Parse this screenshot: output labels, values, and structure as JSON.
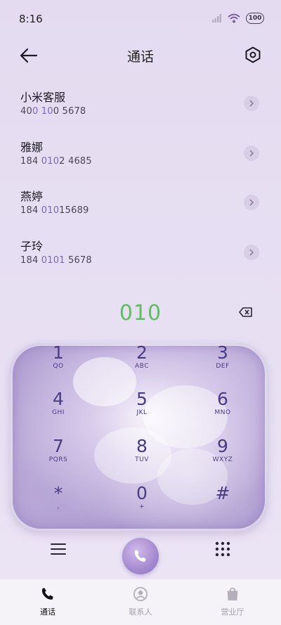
{
  "status": {
    "time": "8:16",
    "battery": "100"
  },
  "header": {
    "title": "通话"
  },
  "contacts": [
    {
      "name": "小米客服",
      "number_pre": "40",
      "number_hl": "0 10",
      "number_post": "0 5678"
    },
    {
      "name": "雅娜",
      "number_pre": "184 ",
      "number_hl": "010",
      "number_post": "2 4685"
    },
    {
      "name": "燕婷",
      "number_pre": "184 ",
      "number_hl": "010",
      "number_post": "15689"
    },
    {
      "name": "子玲",
      "number_pre": "184 ",
      "number_hl": "0101",
      "number_post": " 5678"
    }
  ],
  "dialed_number": "010",
  "keypad": [
    {
      "digit": "1",
      "letters": "QO"
    },
    {
      "digit": "2",
      "letters": "ABC"
    },
    {
      "digit": "3",
      "letters": "DEF"
    },
    {
      "digit": "4",
      "letters": "GHI"
    },
    {
      "digit": "5",
      "letters": "JKL"
    },
    {
      "digit": "6",
      "letters": "MNO"
    },
    {
      "digit": "7",
      "letters": "PQRS"
    },
    {
      "digit": "8",
      "letters": "TUV"
    },
    {
      "digit": "9",
      "letters": "WXYZ"
    },
    {
      "digit": "*",
      "letters": ","
    },
    {
      "digit": "0",
      "letters": "+"
    },
    {
      "digit": "#",
      "letters": ""
    }
  ],
  "tabs": [
    {
      "label": "通话",
      "icon": "phone-icon",
      "active": true
    },
    {
      "label": "联系人",
      "icon": "contact-icon",
      "active": false
    },
    {
      "label": "营业厅",
      "icon": "store-icon",
      "active": false
    }
  ],
  "colors": {
    "accent_green": "#5bc15d",
    "highlight_purple": "#7a68b8",
    "keypad_text": "#4a3c82"
  }
}
